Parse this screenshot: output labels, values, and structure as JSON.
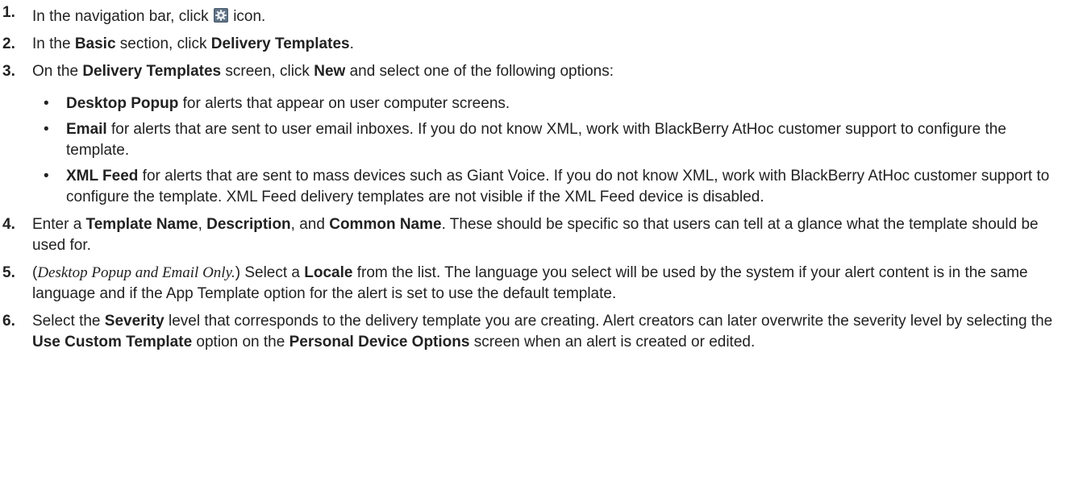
{
  "steps": [
    {
      "num": "1.",
      "p1": "In the navigation bar, click ",
      "icon": "gear-icon",
      "p2": " icon."
    },
    {
      "num": "2.",
      "p1": "In the ",
      "b1": "Basic",
      "p2": " section, click ",
      "b2": "Delivery Templates",
      "p3": "."
    },
    {
      "num": "3.",
      "p1": "On the ",
      "b1": "Delivery Templates",
      "p2": " screen, click ",
      "b2": "New",
      "p3": " and select one of the following options:",
      "bullets": [
        {
          "dot": "•",
          "b": "Desktop Popup",
          "t": " for alerts that appear on user computer screens."
        },
        {
          "dot": "•",
          "b": "Email",
          "t": " for alerts that are sent to user email inboxes. If you do not know XML, work with BlackBerry AtHoc customer support to configure the template."
        },
        {
          "dot": "•",
          "b": "XML Feed",
          "t": " for alerts that are sent to mass devices such as Giant Voice. If you do not know XML, work with BlackBerry AtHoc customer support to configure the template. XML Feed delivery templates are not visible if the XML Feed device is disabled."
        }
      ]
    },
    {
      "num": "4.",
      "p1": "Enter a ",
      "b1": "Template Name",
      "p2": ", ",
      "b2": "Description",
      "p3": ", and ",
      "b3": "Common Name",
      "p4": ". These should be specific so that users can tell at a glance what the template should be used for."
    },
    {
      "num": "5.",
      "p1": "(",
      "i1": "Desktop Popup and Email Only.",
      "p2": ") Select a ",
      "b1": "Locale",
      "p3": " from the list. The language you select will be used by the system if your alert content is in the same language and if the App Template option for the alert is set to use the default template."
    },
    {
      "num": "6.",
      "p1": "Select the ",
      "b1": "Severity",
      "p2": " level that corresponds to the delivery template you are creating. Alert creators can later overwrite the severity level by selecting the ",
      "b2": "Use Custom Template",
      "p3": " option on the ",
      "b3": "Personal Device Options",
      "p4": " screen when an alert is created or edited."
    }
  ]
}
